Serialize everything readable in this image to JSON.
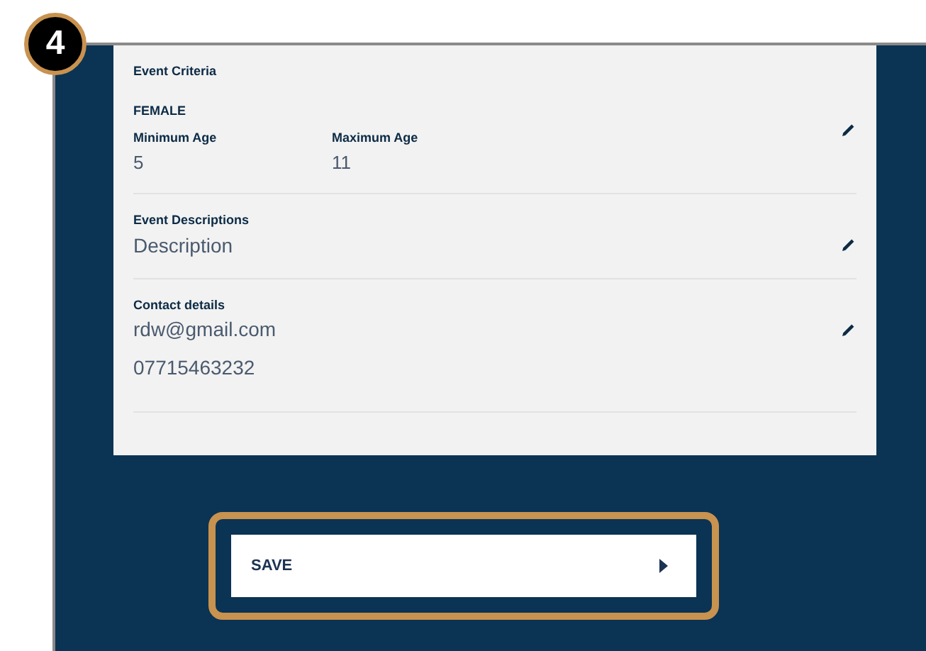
{
  "step_badge": "4",
  "sections": [
    {
      "kind": "criteria",
      "title": "Event Criteria",
      "gender": "FEMALE",
      "fields": [
        {
          "label": "Minimum Age",
          "value": "5"
        },
        {
          "label": "Maximum Age",
          "value": "11"
        }
      ]
    },
    {
      "kind": "lines",
      "title": "Event Descriptions",
      "lines": [
        "Description"
      ]
    },
    {
      "kind": "lines",
      "title": "Contact details",
      "lines": [
        "rdw@gmail.com",
        "07715463232"
      ]
    }
  ],
  "save_button": {
    "label": "SAVE",
    "highlighted": true
  }
}
